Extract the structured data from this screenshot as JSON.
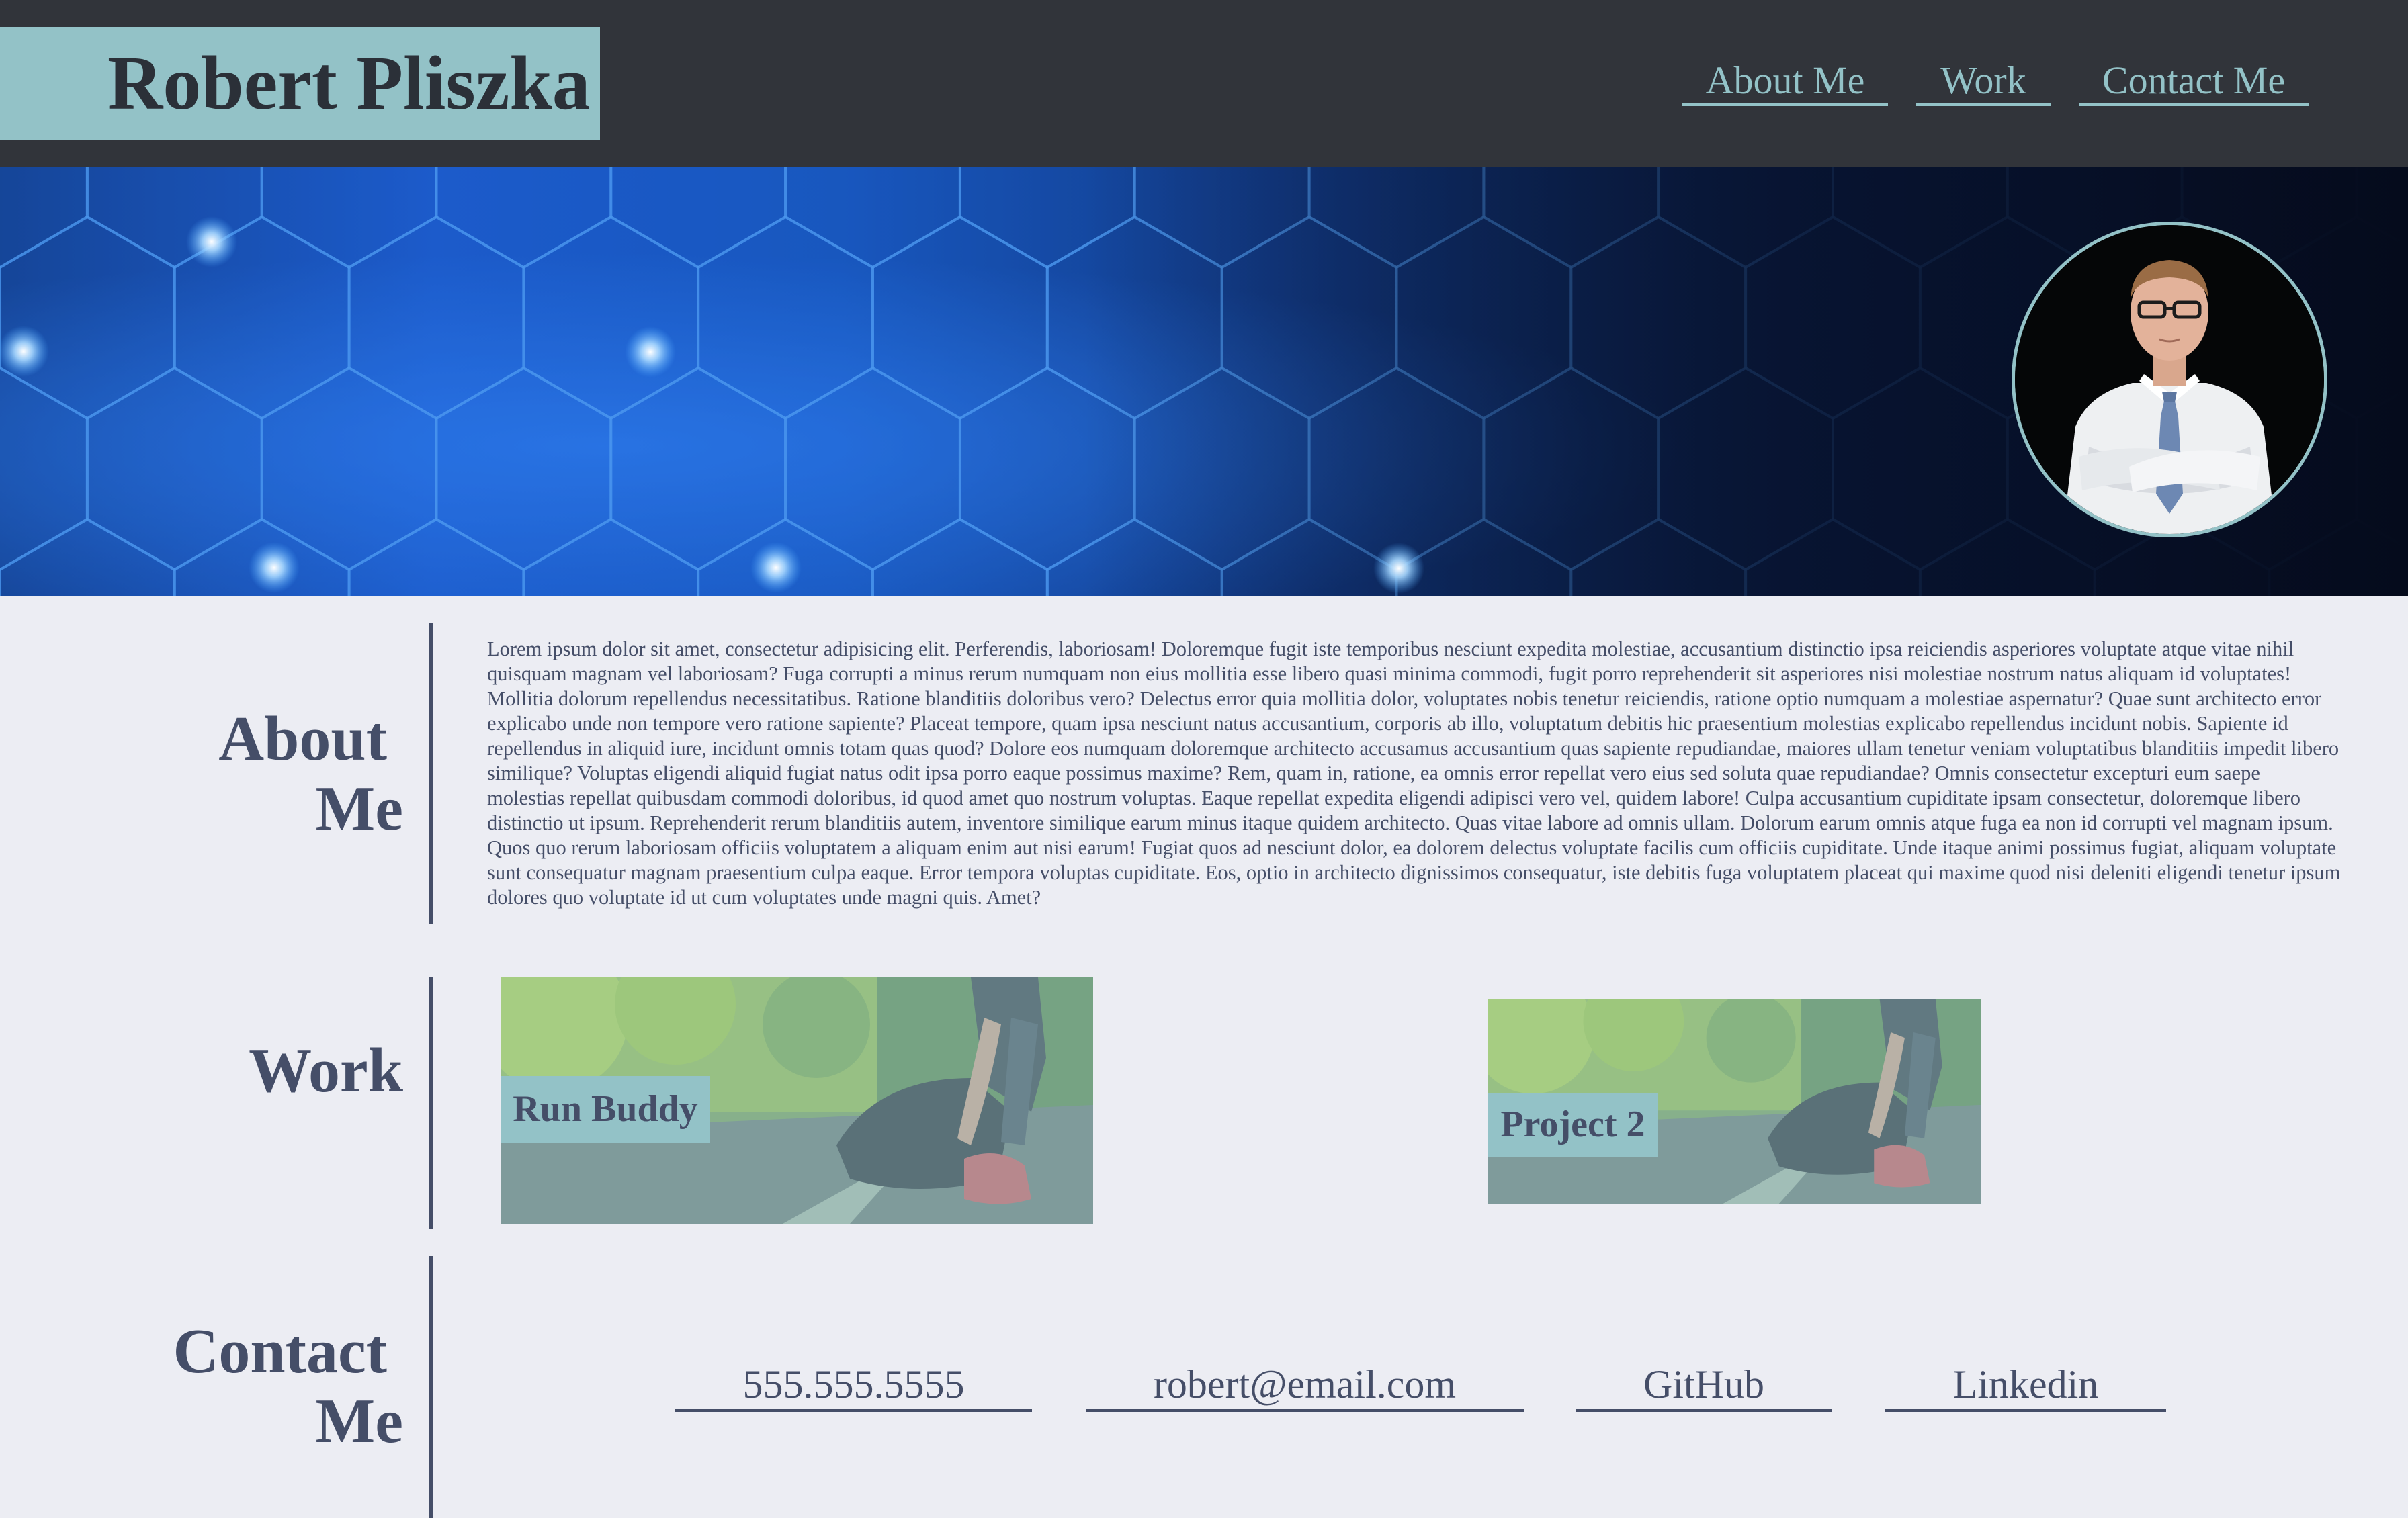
{
  "header": {
    "name": "Robert Pliszka",
    "nav": [
      {
        "label": "About Me"
      },
      {
        "label": "Work"
      },
      {
        "label": "Contact Me"
      }
    ]
  },
  "hero": {
    "background": "blue-hexagon-network-pattern",
    "profile_photo": "man-in-white-shirt-and-tie-portrait"
  },
  "about": {
    "title_line1": "About",
    "title_line2": "Me",
    "body": "Lorem ipsum dolor sit amet, consectetur adipisicing elit. Perferendis, laboriosam! Doloremque fugit iste temporibus nesciunt expedita molestiae, accusantium distinctio ipsa reiciendis asperiores voluptate atque vitae nihil quisquam magnam vel laboriosam? Fuga corrupti a minus rerum numquam non eius mollitia esse libero quasi minima commodi, fugit porro reprehenderit sit asperiores nisi molestiae nostrum natus aliquam id voluptates! Mollitia dolorum repellendus necessitatibus. Ratione blanditiis doloribus vero? Delectus error quia mollitia dolor, voluptates nobis tenetur reiciendis, ratione optio numquam a molestiae aspernatur? Quae sunt architecto error explicabo unde non tempore vero ratione sapiente? Placeat tempore, quam ipsa nesciunt natus accusantium, corporis ab illo, voluptatum debitis hic praesentium molestias explicabo repellendus incidunt nobis. Sapiente id repellendus in aliquid iure, incidunt omnis totam quas quod? Dolore eos numquam doloremque architecto accusamus accusantium quas sapiente repudiandae, maiores ullam tenetur veniam voluptatibus blanditiis impedit libero similique? Voluptas eligendi aliquid fugiat natus odit ipsa porro eaque possimus maxime? Rem, quam in, ratione, ea omnis error repellat vero eius sed soluta quae repudiandae? Omnis consectetur excepturi eum saepe molestias repellat quibusdam commodi doloribus, id quod amet quo nostrum voluptas. Eaque repellat expedita eligendi adipisci vero vel, quidem labore! Culpa accusantium cupiditate ipsam consectetur, doloremque libero distinctio ut ipsum. Reprehenderit rerum blanditiis autem, inventore similique earum minus itaque quidem architecto. Quas vitae labore ad omnis ullam. Dolorum earum omnis atque fuga ea non id corrupti vel magnam ipsum. Quos quo rerum laboriosam officiis voluptatem a aliquam enim aut nisi earum! Fugiat quos ad nesciunt dolor, ea dolorem delectus voluptate facilis cum officiis cupiditate. Unde itaque animi possimus fugiat, aliquam voluptate sunt consequatur magnam praesentium culpa eaque. Error tempora voluptas cupiditate. Eos, optio in architecto dignissimos consequatur, iste debitis fuga voluptatem placeat qui maxime quod nisi deleniti eligendi tenetur ipsum dolores quo voluptate id ut cum voluptates unde magni quis. Amet?"
  },
  "work": {
    "title": "Work",
    "projects": [
      {
        "label": "Run Buddy",
        "image": "runner-tying-shoe-photo"
      },
      {
        "label": "Project 2",
        "image": "runner-tying-shoe-photo"
      }
    ]
  },
  "contact": {
    "title_line1": "Contact",
    "title_line2": "Me",
    "links": [
      {
        "label": "555.555.5555"
      },
      {
        "label": "robert@email.com"
      },
      {
        "label": "GitHub"
      },
      {
        "label": "Linkedin"
      }
    ]
  },
  "colors": {
    "header_bg": "#31343a",
    "accent": "#93c2c7",
    "text_dark": "#454e68",
    "page_bg": "#ecedf3"
  }
}
